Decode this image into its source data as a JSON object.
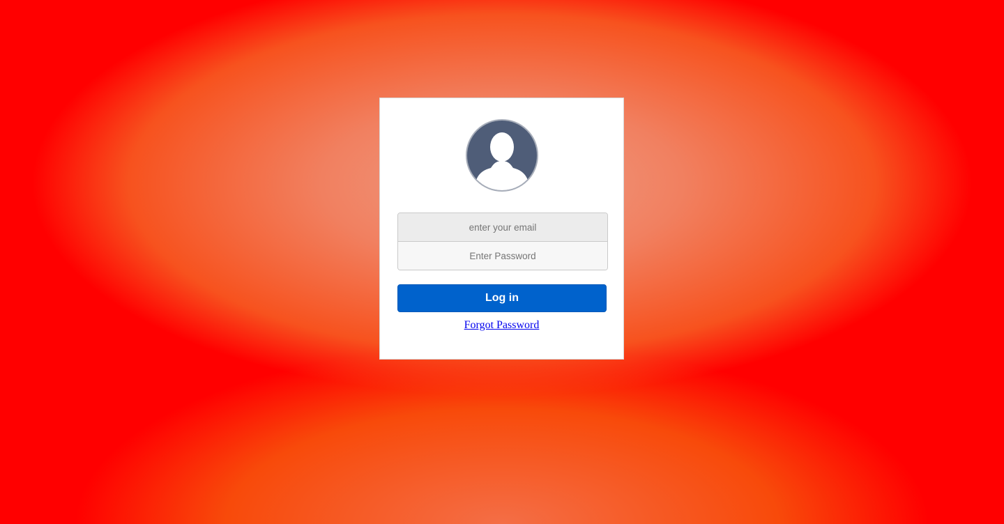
{
  "login": {
    "avatar_icon": "user-silhouette-icon",
    "email_placeholder": "enter your email",
    "email_value": "",
    "password_placeholder": "Enter Password",
    "password_value": "",
    "login_label": "Log in",
    "forgot_label": "Forgot Password"
  },
  "colors": {
    "background_edge": "#ff0000",
    "background_center": "#ef9c84",
    "button": "#0062cc",
    "avatar": "#4f5d78",
    "link": "#0000ee"
  }
}
